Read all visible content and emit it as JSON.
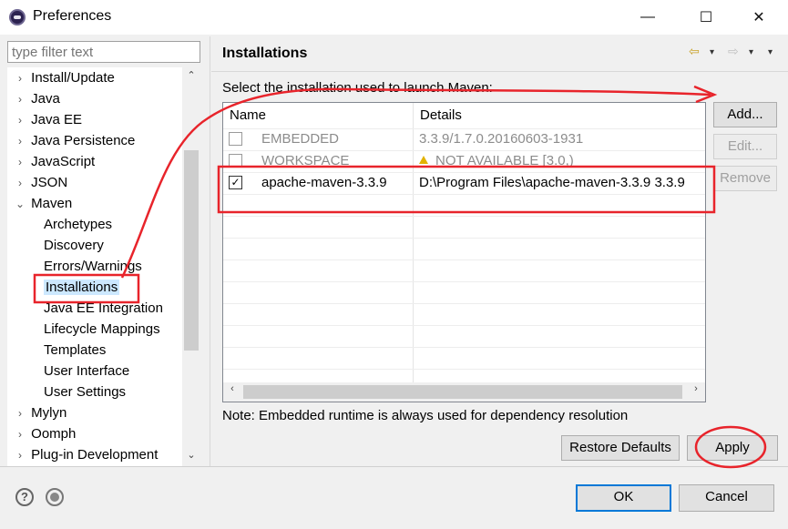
{
  "window": {
    "title": "Preferences",
    "controls": {
      "minimize": "—",
      "maximize": "☐",
      "close": "✕"
    }
  },
  "filter": {
    "placeholder": "type filter text"
  },
  "tree": {
    "items": [
      {
        "label": "Install/Update",
        "expander": "›"
      },
      {
        "label": "Java",
        "expander": "›"
      },
      {
        "label": "Java EE",
        "expander": "›"
      },
      {
        "label": "Java Persistence",
        "expander": "›"
      },
      {
        "label": "JavaScript",
        "expander": "›"
      },
      {
        "label": "JSON",
        "expander": "›"
      },
      {
        "label": "Maven",
        "expander": "⌄"
      },
      {
        "label": "Archetypes",
        "expander": ""
      },
      {
        "label": "Discovery",
        "expander": ""
      },
      {
        "label": "Errors/Warnings",
        "expander": ""
      },
      {
        "label": "Installations",
        "expander": "",
        "selected": true
      },
      {
        "label": "Java EE Integration",
        "expander": ""
      },
      {
        "label": "Lifecycle Mappings",
        "expander": ""
      },
      {
        "label": "Templates",
        "expander": ""
      },
      {
        "label": "User Interface",
        "expander": ""
      },
      {
        "label": "User Settings",
        "expander": ""
      },
      {
        "label": "Mylyn",
        "expander": "›"
      },
      {
        "label": "Oomph",
        "expander": "›"
      },
      {
        "label": "Plug-in Development",
        "expander": "›"
      }
    ],
    "scroll_up": "⌃",
    "scroll_down": "⌄"
  },
  "page": {
    "title": "Installations",
    "description": "Select the installation used to launch Maven:",
    "nav": {
      "back": "⇦",
      "dropdown": "▾",
      "forward": "⇨"
    },
    "table": {
      "columns": [
        "Name",
        "Details"
      ],
      "rows": [
        {
          "checked": false,
          "check_mark": "",
          "name": "EMBEDDED",
          "details": "3.3.9/1.7.0.20160603-1931",
          "disabled": true,
          "warning": false
        },
        {
          "checked": false,
          "check_mark": "",
          "name": "WORKSPACE",
          "details": "NOT AVAILABLE [3.0,)",
          "disabled": true,
          "warning": true
        },
        {
          "checked": true,
          "check_mark": "✓",
          "name": "apache-maven-3.3.9",
          "details": "D:\\Program Files\\apache-maven-3.3.9 3.3.9",
          "disabled": false,
          "warning": false
        }
      ],
      "scroll_left": "‹",
      "scroll_right": "›"
    },
    "buttons": {
      "add": "Add...",
      "edit": "Edit...",
      "remove": "Remove"
    },
    "note": "Note: Embedded runtime is always used for dependency resolution",
    "restore_defaults": "Restore Defaults",
    "apply": "Apply"
  },
  "footer": {
    "help_icon": "?",
    "ok": "OK",
    "cancel": "Cancel"
  },
  "colors": {
    "annotation": "#e8242b",
    "selection": "#cce8ff",
    "default_button_border": "#0078d7"
  }
}
